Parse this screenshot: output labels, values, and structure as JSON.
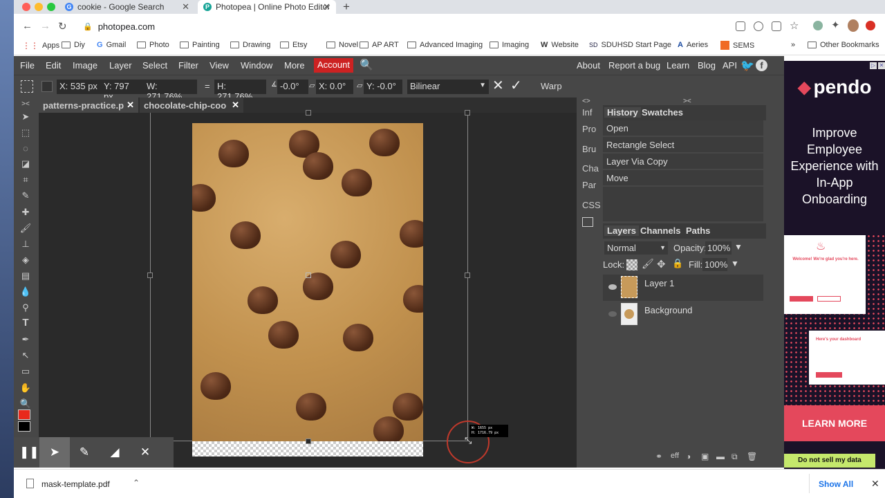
{
  "browser": {
    "tabs": [
      {
        "title": "cookie - Google Search",
        "active": false
      },
      {
        "title": "Photopea | Online Photo Editor",
        "active": true
      }
    ],
    "new_tab": "+",
    "url": "photopea.com",
    "bookmarks": [
      "Apps",
      "Diy",
      "Gmail",
      "Photo",
      "Painting",
      "Drawing",
      "Etsy",
      "Novel",
      "AP ART",
      "Advanced Imaging",
      "Imaging",
      "Website",
      "SDUHSD Start Page",
      "Aeries",
      "SEMS"
    ],
    "bookmarks_more": "»",
    "other_bookmarks": "Other Bookmarks"
  },
  "menu": {
    "items": [
      "File",
      "Edit",
      "Image",
      "Layer",
      "Select",
      "Filter",
      "View",
      "Window",
      "More"
    ],
    "account": "Account",
    "right_links": [
      "About",
      "Report a bug",
      "Learn",
      "Blog",
      "API"
    ]
  },
  "options": {
    "x": "X: 535 px",
    "y": "Y: 797 px",
    "w": "W: 271.76%",
    "eq": "=",
    "h": "H: 271.76%",
    "rot": "-0.0°",
    "skew_x_label": "X:",
    "skew_x": "0.0°",
    "skew_y_label": "Y:",
    "skew_y": "-0.0°",
    "interp": "Bilinear",
    "warp": "Warp"
  },
  "doc_tabs": [
    {
      "title": "patterns-practice.p",
      "active": true
    },
    {
      "title": "chocolate-chip-coo",
      "active": false
    }
  ],
  "size_readout": {
    "w": "W: 1655 px",
    "h": "H: 1716.79 px"
  },
  "mini_panel": [
    "Inf",
    "Pro",
    "Bru",
    "Cha",
    "Par",
    "CSS"
  ],
  "history": {
    "tabs": [
      "History",
      "Swatches"
    ],
    "items": [
      "Open",
      "Rectangle Select",
      "Layer Via Copy",
      "Move"
    ]
  },
  "layers": {
    "tabs": [
      "Layers",
      "Channels",
      "Paths"
    ],
    "blend": "Normal",
    "opacity_label": "Opacity:",
    "opacity": "100%",
    "lock_label": "Lock:",
    "fill_label": "Fill:",
    "fill": "100%",
    "items": [
      "Layer 1",
      "Background"
    ],
    "footer_eff": "eff"
  },
  "ad": {
    "brand": "pendo",
    "headline": "Improve Employee Experience with In-App Onboarding",
    "card1_title": "Welcome! We're glad you're here.",
    "card2_title": "Here's your dashboard",
    "cta": "LEARN MORE",
    "dnsmd": "Do not sell my data"
  },
  "download": {
    "file": "mask-template.pdf",
    "show_all": "Show All"
  },
  "colors": {
    "account": "#cc2222",
    "foreground": "#e8291c"
  }
}
